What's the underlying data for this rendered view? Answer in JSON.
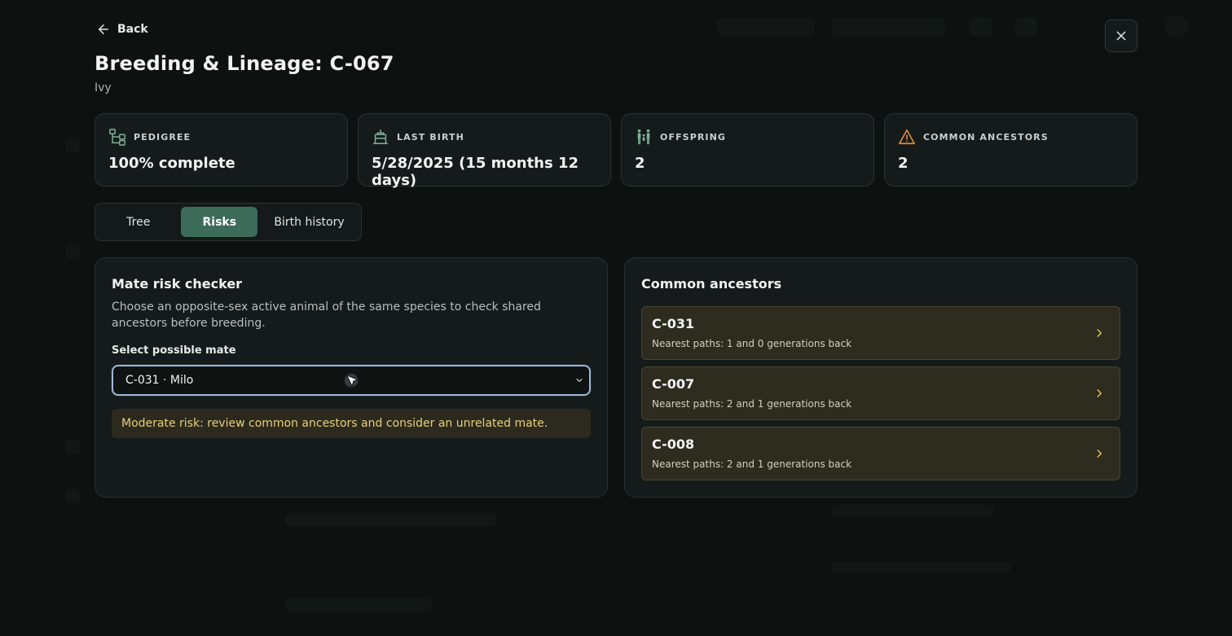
{
  "header": {
    "back_label": "Back",
    "title": "Breeding & Lineage: C-067",
    "subtitle": "Ivy"
  },
  "stats": [
    {
      "label": "PEDIGREE",
      "value": "100% complete",
      "icon": "pedigree-icon",
      "color": "#7fb39a"
    },
    {
      "label": "LAST BIRTH",
      "value": "5/28/2025 (15 months 12 days)",
      "icon": "cake-icon",
      "color": "#7fb39a"
    },
    {
      "label": "OFFSPRING",
      "value": "2",
      "icon": "family-icon",
      "color": "#7fb39a"
    },
    {
      "label": "COMMON ANCESTORS",
      "value": "2",
      "icon": "warning-icon",
      "color": "#e08a3c"
    }
  ],
  "tabs": [
    {
      "label": "Tree",
      "active": false
    },
    {
      "label": "Risks",
      "active": true
    },
    {
      "label": "Birth history",
      "active": false
    }
  ],
  "mate_checker": {
    "title": "Mate risk checker",
    "description": "Choose an opposite-sex active animal of the same species to check shared ancestors before breeding.",
    "field_label": "Select possible mate",
    "selected_value": "C-031 · Milo",
    "risk_message": "Moderate risk: review common ancestors and consider an unrelated mate."
  },
  "common_ancestors": {
    "title": "Common ancestors",
    "items": [
      {
        "id": "C-031",
        "path": "Nearest paths: 1 and 0 generations back"
      },
      {
        "id": "C-007",
        "path": "Nearest paths: 2 and 1 generations back"
      },
      {
        "id": "C-008",
        "path": "Nearest paths: 2 and 1 generations back"
      }
    ]
  },
  "colors": {
    "accent": "#3d6b5a",
    "warning_bg": "#2c2a1e",
    "warning_text": "#e7cf79",
    "chevron": "#e7c35a"
  }
}
